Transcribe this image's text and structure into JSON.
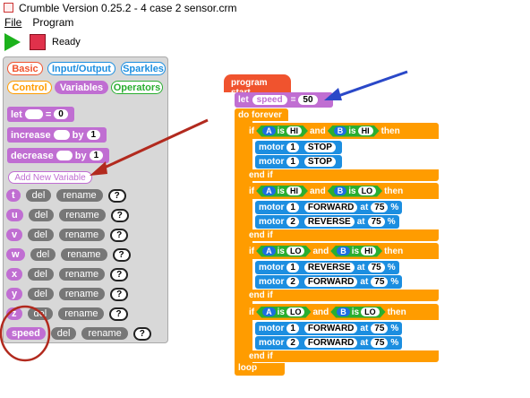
{
  "window": {
    "title": "Crumble Version 0.25.2 - 4 case 2 sensor.crm"
  },
  "menu": {
    "file": "File",
    "program": "Program"
  },
  "toolbar": {
    "status": "Ready"
  },
  "categories": {
    "basic": "Basic",
    "io": "Input/Output",
    "sparkles": "Sparkles",
    "control": "Control",
    "variables": "Variables",
    "operators": "Operators"
  },
  "palette_blocks": {
    "let_label": "let",
    "let_value": "0",
    "increase_label": "increase",
    "increase_by": "by",
    "increase_value": "1",
    "decrease_label": "decrease",
    "decrease_by": "by",
    "decrease_value": "1",
    "add_new_variable": "Add New Variable"
  },
  "variable_row_labels": {
    "del": "del",
    "rename": "rename",
    "help": "?"
  },
  "variables": [
    "t",
    "u",
    "v",
    "w",
    "x",
    "y",
    "z",
    "speed"
  ],
  "program": {
    "start": "program start",
    "let": "let",
    "var": "speed",
    "eq": "=",
    "val": "50",
    "do_forever": "do forever",
    "if": "if",
    "then": "then",
    "end_if": "end if",
    "and": "and",
    "is": "is",
    "motor": "motor",
    "at": "at",
    "pct": "%",
    "loop": "loop",
    "cases": [
      {
        "a": "HI",
        "b": "HI",
        "m1": [
          "1",
          "STOP"
        ],
        "m2": [
          "1",
          "STOP"
        ]
      },
      {
        "a": "HI",
        "b": "LO",
        "m1": [
          "1",
          "FORWARD",
          "75"
        ],
        "m2": [
          "2",
          "REVERSE",
          "75"
        ]
      },
      {
        "a": "LO",
        "b": "HI",
        "m1": [
          "1",
          "REVERSE",
          "75"
        ],
        "m2": [
          "2",
          "FORWARD",
          "75"
        ]
      },
      {
        "a": "LO",
        "b": "LO",
        "m1": [
          "1",
          "FORWARD",
          "75"
        ],
        "m2": [
          "2",
          "FORWARD",
          "75"
        ]
      }
    ],
    "sensor_a": "A",
    "sensor_b": "B"
  },
  "colors": {
    "variable": "#c06ed2",
    "control": "#ff9c00",
    "motor": "#1c8ee0",
    "compare": "#2aae30",
    "hat": "#f0532e",
    "annotation_red": "#b22a1e",
    "annotation_blue": "#2a48c8"
  }
}
